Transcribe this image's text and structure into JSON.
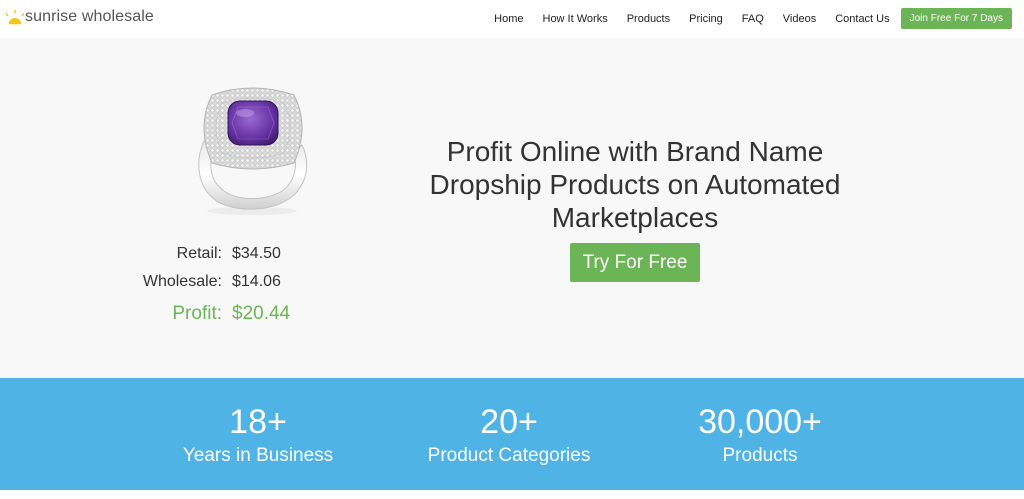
{
  "brand": {
    "name": "sunrise wholesale",
    "accent": "#6cb556",
    "blue": "#4fb3e5",
    "logo_icon": "sun-icon"
  },
  "nav": {
    "items": [
      "Home",
      "How It Works",
      "Products",
      "Pricing",
      "FAQ",
      "Videos",
      "Contact Us"
    ],
    "cta": "Join Free For 7 Days"
  },
  "hero": {
    "product_image": "ring-image",
    "prices": {
      "retail_label": "Retail:",
      "retail_value": "$34.50",
      "wholesale_label": "Wholesale:",
      "wholesale_value": "$14.06",
      "profit_label": "Profit:",
      "profit_value": "$20.44"
    },
    "headline": "Profit Online with Brand Name Dropship Products on Automated Marketplaces",
    "cta": "Try For Free"
  },
  "stats": [
    {
      "number": "18+",
      "label": "Years in Business"
    },
    {
      "number": "20+",
      "label": "Product Categories"
    },
    {
      "number": "30,000+",
      "label": "Products"
    }
  ]
}
